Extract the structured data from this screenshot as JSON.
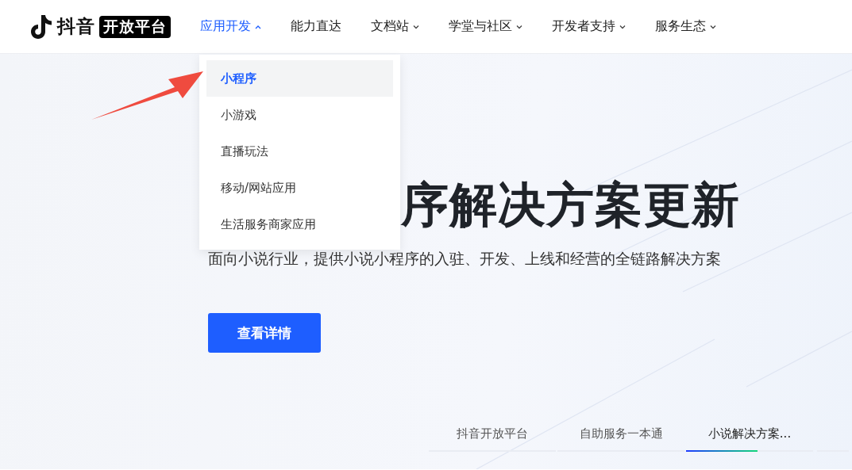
{
  "logo": {
    "name": "抖音",
    "badge": "开放平台"
  },
  "nav": [
    {
      "label": "应用开发",
      "selected": true,
      "has_menu": true,
      "expanded": true
    },
    {
      "label": "能力直达",
      "selected": false,
      "has_menu": false,
      "expanded": false
    },
    {
      "label": "文档站",
      "selected": false,
      "has_menu": true,
      "expanded": false
    },
    {
      "label": "学堂与社区",
      "selected": false,
      "has_menu": true,
      "expanded": false
    },
    {
      "label": "开发者支持",
      "selected": false,
      "has_menu": true,
      "expanded": false
    },
    {
      "label": "服务生态",
      "selected": false,
      "has_menu": true,
      "expanded": false
    }
  ],
  "dropdown": {
    "items": [
      {
        "label": "小程序",
        "selected": true
      },
      {
        "label": "小游戏",
        "selected": false
      },
      {
        "label": "直播玩法",
        "selected": false
      },
      {
        "label": "移动/网站应用",
        "selected": false
      },
      {
        "label": "生活服务商家应用",
        "selected": false
      }
    ]
  },
  "hero": {
    "title": "序解决方案更新",
    "subtitle": "面向小说行业，提供小说小程序的入驻、开发、上线和经营的全链路解决方案",
    "button": "查看详情"
  },
  "carousel_tabs": [
    {
      "label": "抖音开放平台",
      "selected": false
    },
    {
      "label": "自助服务一本通",
      "selected": false
    },
    {
      "label": "小说解决方案...",
      "selected": true
    }
  ]
}
